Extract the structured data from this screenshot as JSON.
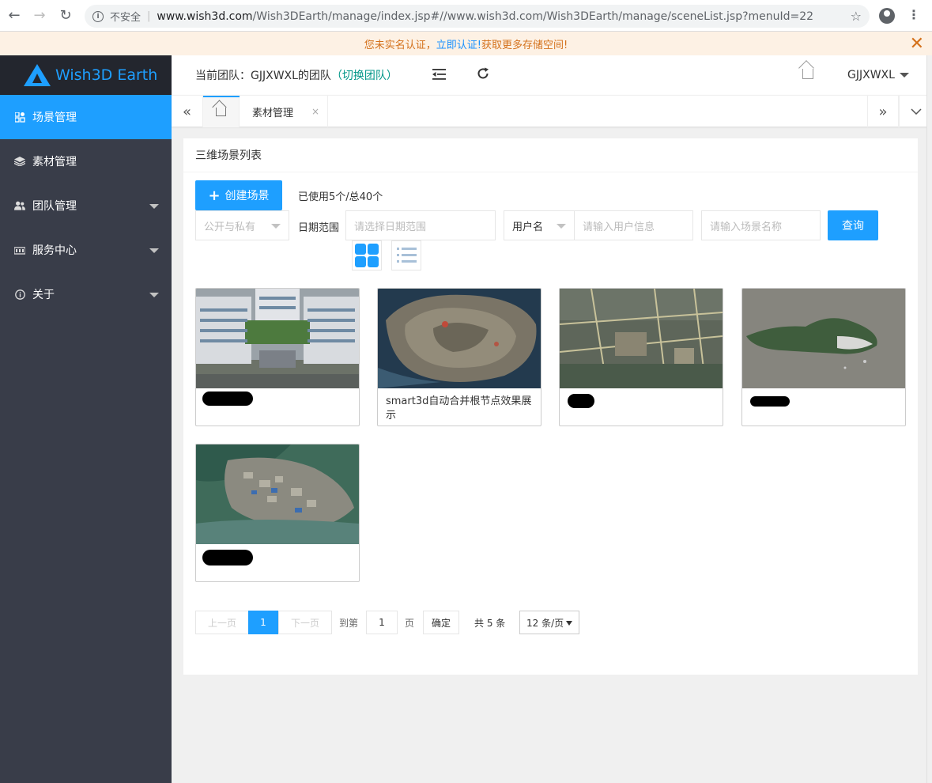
{
  "browser": {
    "insecure_label": "不安全",
    "url_host": "www.wish3d.com",
    "url_path": "/Wish3DEarth/manage/index.jsp#//www.wish3d.com/Wish3DEarth/manage/sceneList.jsp?menuId=22"
  },
  "notice": {
    "text_before": "您未实名认证，",
    "link": "立即认证!",
    "text_after": "获取更多存储空间!",
    "close": "✕"
  },
  "sidebar": {
    "brand": "Wish3D Earth",
    "items": [
      {
        "label": "场景管理",
        "icon": "scene-icon",
        "active": true
      },
      {
        "label": "素材管理",
        "icon": "layers-icon"
      },
      {
        "label": "团队管理",
        "icon": "users-icon"
      },
      {
        "label": "服务中心",
        "icon": "server-icon"
      },
      {
        "label": "关于",
        "icon": "info-icon"
      }
    ]
  },
  "header": {
    "team_prefix": "当前团队：GJJXWXL的团队",
    "switch_team": "（切换团队）",
    "username": "GJJXWXL"
  },
  "tabs": {
    "material_tab": "素材管理",
    "close": "×"
  },
  "main": {
    "title": "三维场景列表",
    "create_button": "创建场景",
    "usage": "已使用5个/总40个",
    "filter": {
      "visibility_placeholder": "公开与私有",
      "date_label": "日期范围",
      "date_placeholder": "请选择日期范围",
      "user_field": "用户名",
      "user_placeholder": "请输入用户信息",
      "scene_placeholder": "请输入场景名称",
      "query_button": "查询"
    },
    "scenes": [
      {
        "caption": "",
        "redacted": true
      },
      {
        "caption": "smart3d自动合并根节点效果展示",
        "redacted": false
      },
      {
        "caption": "",
        "redacted": true
      },
      {
        "caption": "",
        "redacted": true
      },
      {
        "caption": "",
        "redacted": true
      }
    ]
  },
  "pagination": {
    "prev": "上一页",
    "current": "1",
    "next": "下一页",
    "goto_label": "到第",
    "goto_value": "1",
    "page_unit": "页",
    "confirm": "确定",
    "total": "共 5 条",
    "page_size": "12 条/页"
  },
  "colors": {
    "accent": "#1e9fff",
    "sidebar_bg": "#393d49",
    "logo_bg": "#23262e",
    "notice_text": "#d4711b"
  }
}
